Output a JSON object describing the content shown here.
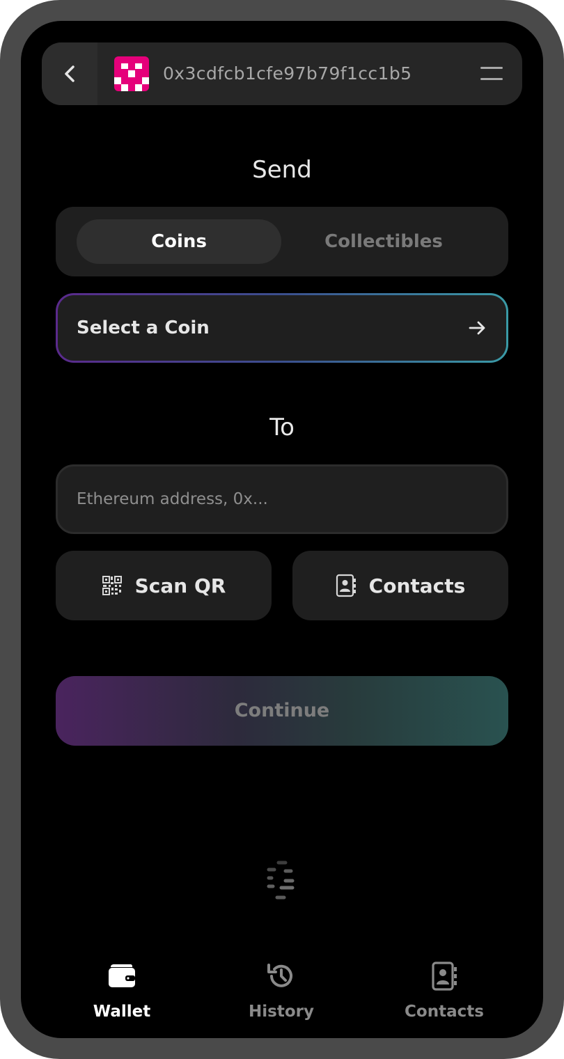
{
  "header": {
    "wallet_address": "0x3cdfcb1cfe97b79f1cc1b5",
    "back_icon": "chevron-left-icon",
    "menu_icon": "hamburger-menu-icon",
    "avatar_color": "#e5007a"
  },
  "send": {
    "title": "Send",
    "tabs": [
      {
        "label": "Coins",
        "active": true
      },
      {
        "label": "Collectibles",
        "active": false
      }
    ],
    "coin_select": {
      "label": "Select a Coin",
      "icon": "arrow-right-icon"
    }
  },
  "recipient": {
    "title": "To",
    "address_input": {
      "placeholder": "Ethereum address, 0x...",
      "value": ""
    },
    "scan_qr": {
      "label": "Scan QR",
      "icon": "qr-code-icon"
    },
    "contacts": {
      "label": "Contacts",
      "icon": "contacts-book-icon"
    }
  },
  "continue_button": {
    "label": "Continue",
    "enabled": false
  },
  "loader": {
    "icon": "loading-spinner-icon"
  },
  "tabbar": {
    "items": [
      {
        "label": "Wallet",
        "icon": "wallet-icon",
        "active": true
      },
      {
        "label": "History",
        "icon": "history-icon",
        "active": false
      },
      {
        "label": "Contacts",
        "icon": "contacts-book-icon",
        "active": false
      }
    ]
  },
  "colors": {
    "accent_purple": "#5a2a8c",
    "accent_teal": "#3a9aa6",
    "surface": "#1f1f1f",
    "background": "#000000"
  }
}
